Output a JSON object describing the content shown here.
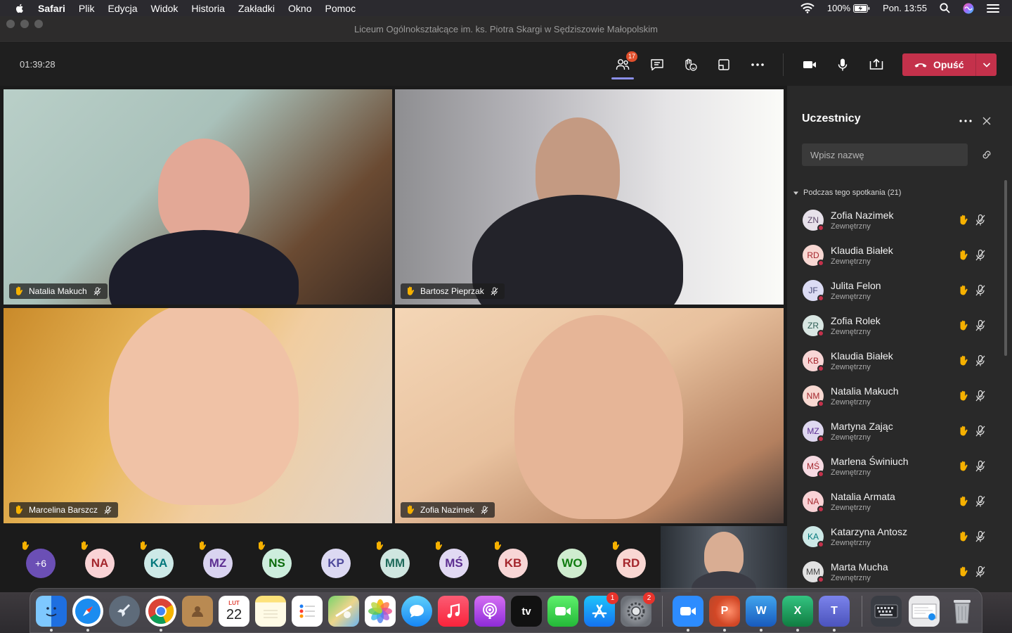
{
  "menubar": {
    "app": "Safari",
    "items": [
      "Plik",
      "Edycja",
      "Widok",
      "Historia",
      "Zakładki",
      "Okno",
      "Pomoc"
    ],
    "battery": "100%",
    "clock": "Pon. 13:55"
  },
  "window": {
    "title": "Liceum Ogólnokształcące im. ks. Piotra Skargi w Sędziszowie Małopolskim"
  },
  "toolbar": {
    "timer": "01:39:28",
    "participants_badge": "17",
    "leave_label": "Opuść"
  },
  "tiles": [
    {
      "name": "Natalia Makuch"
    },
    {
      "name": "Bartosz Pieprzak"
    },
    {
      "name": "Marcelina Barszcz"
    },
    {
      "name": "Zofia Nazimek"
    }
  ],
  "strip": {
    "more_label": "+6",
    "avatars": [
      {
        "initials": "NA",
        "bg": "#f9d3d6",
        "fg": "#a4262c"
      },
      {
        "initials": "KA",
        "bg": "#cde9e7",
        "fg": "#03787c"
      },
      {
        "initials": "MZ",
        "bg": "#d9d3f0",
        "fg": "#5c2e91"
      },
      {
        "initials": "NS",
        "bg": "#cdeddd",
        "fg": "#0b6a0b"
      },
      {
        "initials": "KP",
        "bg": "#dcd9f2",
        "fg": "#4f4a9c"
      },
      {
        "initials": "MM",
        "bg": "#cfe6e0",
        "fg": "#1f6b5b"
      },
      {
        "initials": "MŚ",
        "bg": "#e1d9f3",
        "fg": "#5c2e91"
      },
      {
        "initials": "KB",
        "bg": "#f8d6d6",
        "fg": "#a4262c"
      },
      {
        "initials": "WO",
        "bg": "#cfeccf",
        "fg": "#107c10"
      },
      {
        "initials": "RD",
        "bg": "#f9d7d3",
        "fg": "#a4262c"
      }
    ]
  },
  "pane": {
    "title": "Uczestnicy",
    "search_placeholder": "Wpisz nazwę",
    "section_label": "Podczas tego spotkania (21)",
    "participants": [
      {
        "initials": "ZN",
        "name": "Zofia Nazimek",
        "sub": "Zewnętrzny",
        "bg": "#e7e1ea",
        "fg": "#5e4a6a"
      },
      {
        "initials": "RD",
        "name": "Klaudia Białek",
        "sub": "Zewnętrzny",
        "bg": "#f8d8d3",
        "fg": "#a4262c"
      },
      {
        "initials": "JF",
        "name": "Julita Felon",
        "sub": "Zewnętrzny",
        "bg": "#dcdcf4",
        "fg": "#464775"
      },
      {
        "initials": "ZR",
        "name": "Zofia Rolek",
        "sub": "Zewnętrzny",
        "bg": "#d9e7e3",
        "fg": "#2e5e55"
      },
      {
        "initials": "KB",
        "name": "Klaudia Białek",
        "sub": "Zewnętrzny",
        "bg": "#f8d6d6",
        "fg": "#a4262c"
      },
      {
        "initials": "NM",
        "name": "Natalia Makuch",
        "sub": "Zewnętrzny",
        "bg": "#f8d9d2",
        "fg": "#a4262c"
      },
      {
        "initials": "MZ",
        "name": "Martyna Zając",
        "sub": "Zewnętrzny",
        "bg": "#dfd8f0",
        "fg": "#5c2e91"
      },
      {
        "initials": "MŚ",
        "name": "Marlena Świniuch",
        "sub": "Zewnętrzny",
        "bg": "#f6dae2",
        "fg": "#a4262c"
      },
      {
        "initials": "NA",
        "name": "Natalia Armata",
        "sub": "Zewnętrzny",
        "bg": "#f9d3d6",
        "fg": "#a4262c"
      },
      {
        "initials": "KA",
        "name": "Katarzyna Antosz",
        "sub": "Zewnętrzny",
        "bg": "#cde9e7",
        "fg": "#03787c"
      },
      {
        "initials": "MM",
        "name": "Marta Mucha",
        "sub": "Zewnętrzny",
        "bg": "#e2e2e2",
        "fg": "#444444"
      }
    ]
  },
  "dock": {
    "calendar_month": "LUT",
    "calendar_day": "22",
    "appstore_badge": "1",
    "settings_badge": "2",
    "tv_label": "tv"
  }
}
